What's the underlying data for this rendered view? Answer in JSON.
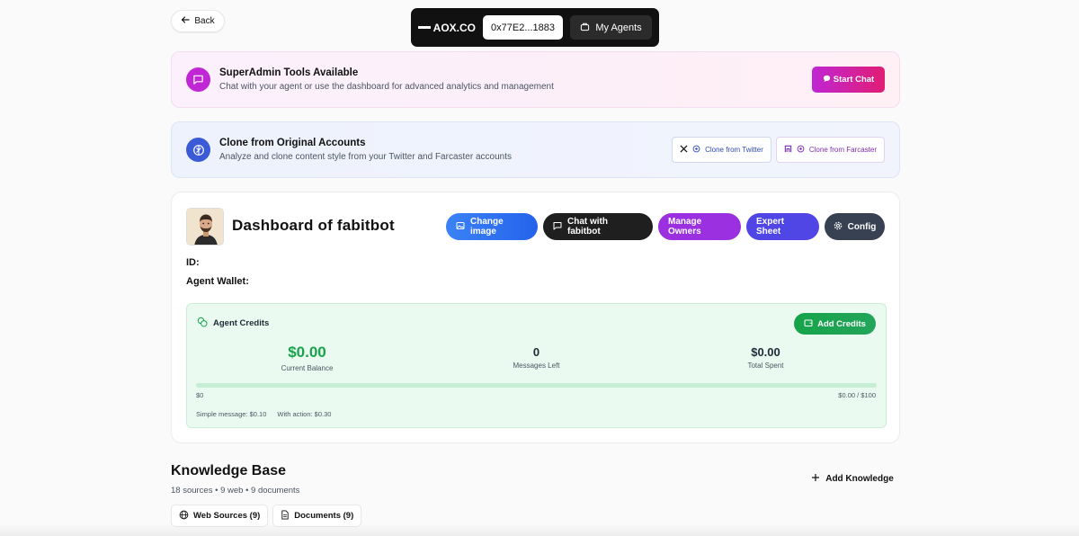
{
  "nav": {
    "back_label": "Back",
    "brand": "AOX.CO",
    "wallet_short": "0x77E2...1883",
    "my_agents_label": "My Agents"
  },
  "superadmin": {
    "title": "SuperAdmin Tools Available",
    "subtitle": "Chat with your agent or use the dashboard for advanced analytics and management",
    "start_chat_label": "Start Chat"
  },
  "clone": {
    "title": "Clone from Original Accounts",
    "subtitle": "Analyze and clone content style from your Twitter and Farcaster accounts",
    "twitter_label": "Clone from Twitter",
    "farcaster_label": "Clone from Farcaster"
  },
  "dashboard": {
    "title": "Dashboard of fabitbot",
    "actions": {
      "change_image": "Change image",
      "chat": "Chat with fabitbot",
      "manage_owners": "Manage Owners",
      "expert_sheet": "Expert Sheet",
      "config": "Config"
    },
    "id_label": "ID:",
    "wallet_label": "Agent Wallet:"
  },
  "credits": {
    "title": "Agent Credits",
    "add_label": "Add Credits",
    "balance": "$0.00",
    "balance_label": "Current Balance",
    "messages": "0",
    "messages_label": "Messages Left",
    "spent": "$0.00",
    "spent_label": "Total Spent",
    "progress_fraction": 0,
    "progress_min": "$0",
    "progress_max": "$0.00 / $100",
    "simple_price": "Simple message: $0.10",
    "action_price": "With action: $0.30"
  },
  "knowledge": {
    "title": "Knowledge Base",
    "summary": "18 sources • 9 web • 9 documents",
    "add_label": "Add Knowledge",
    "tabs": {
      "web": "Web Sources (9)",
      "docs": "Documents (9)"
    }
  },
  "colors": {
    "accent_pink": "#c026d3",
    "accent_blue": "#2563eb",
    "credits_green": "#16a34a"
  }
}
